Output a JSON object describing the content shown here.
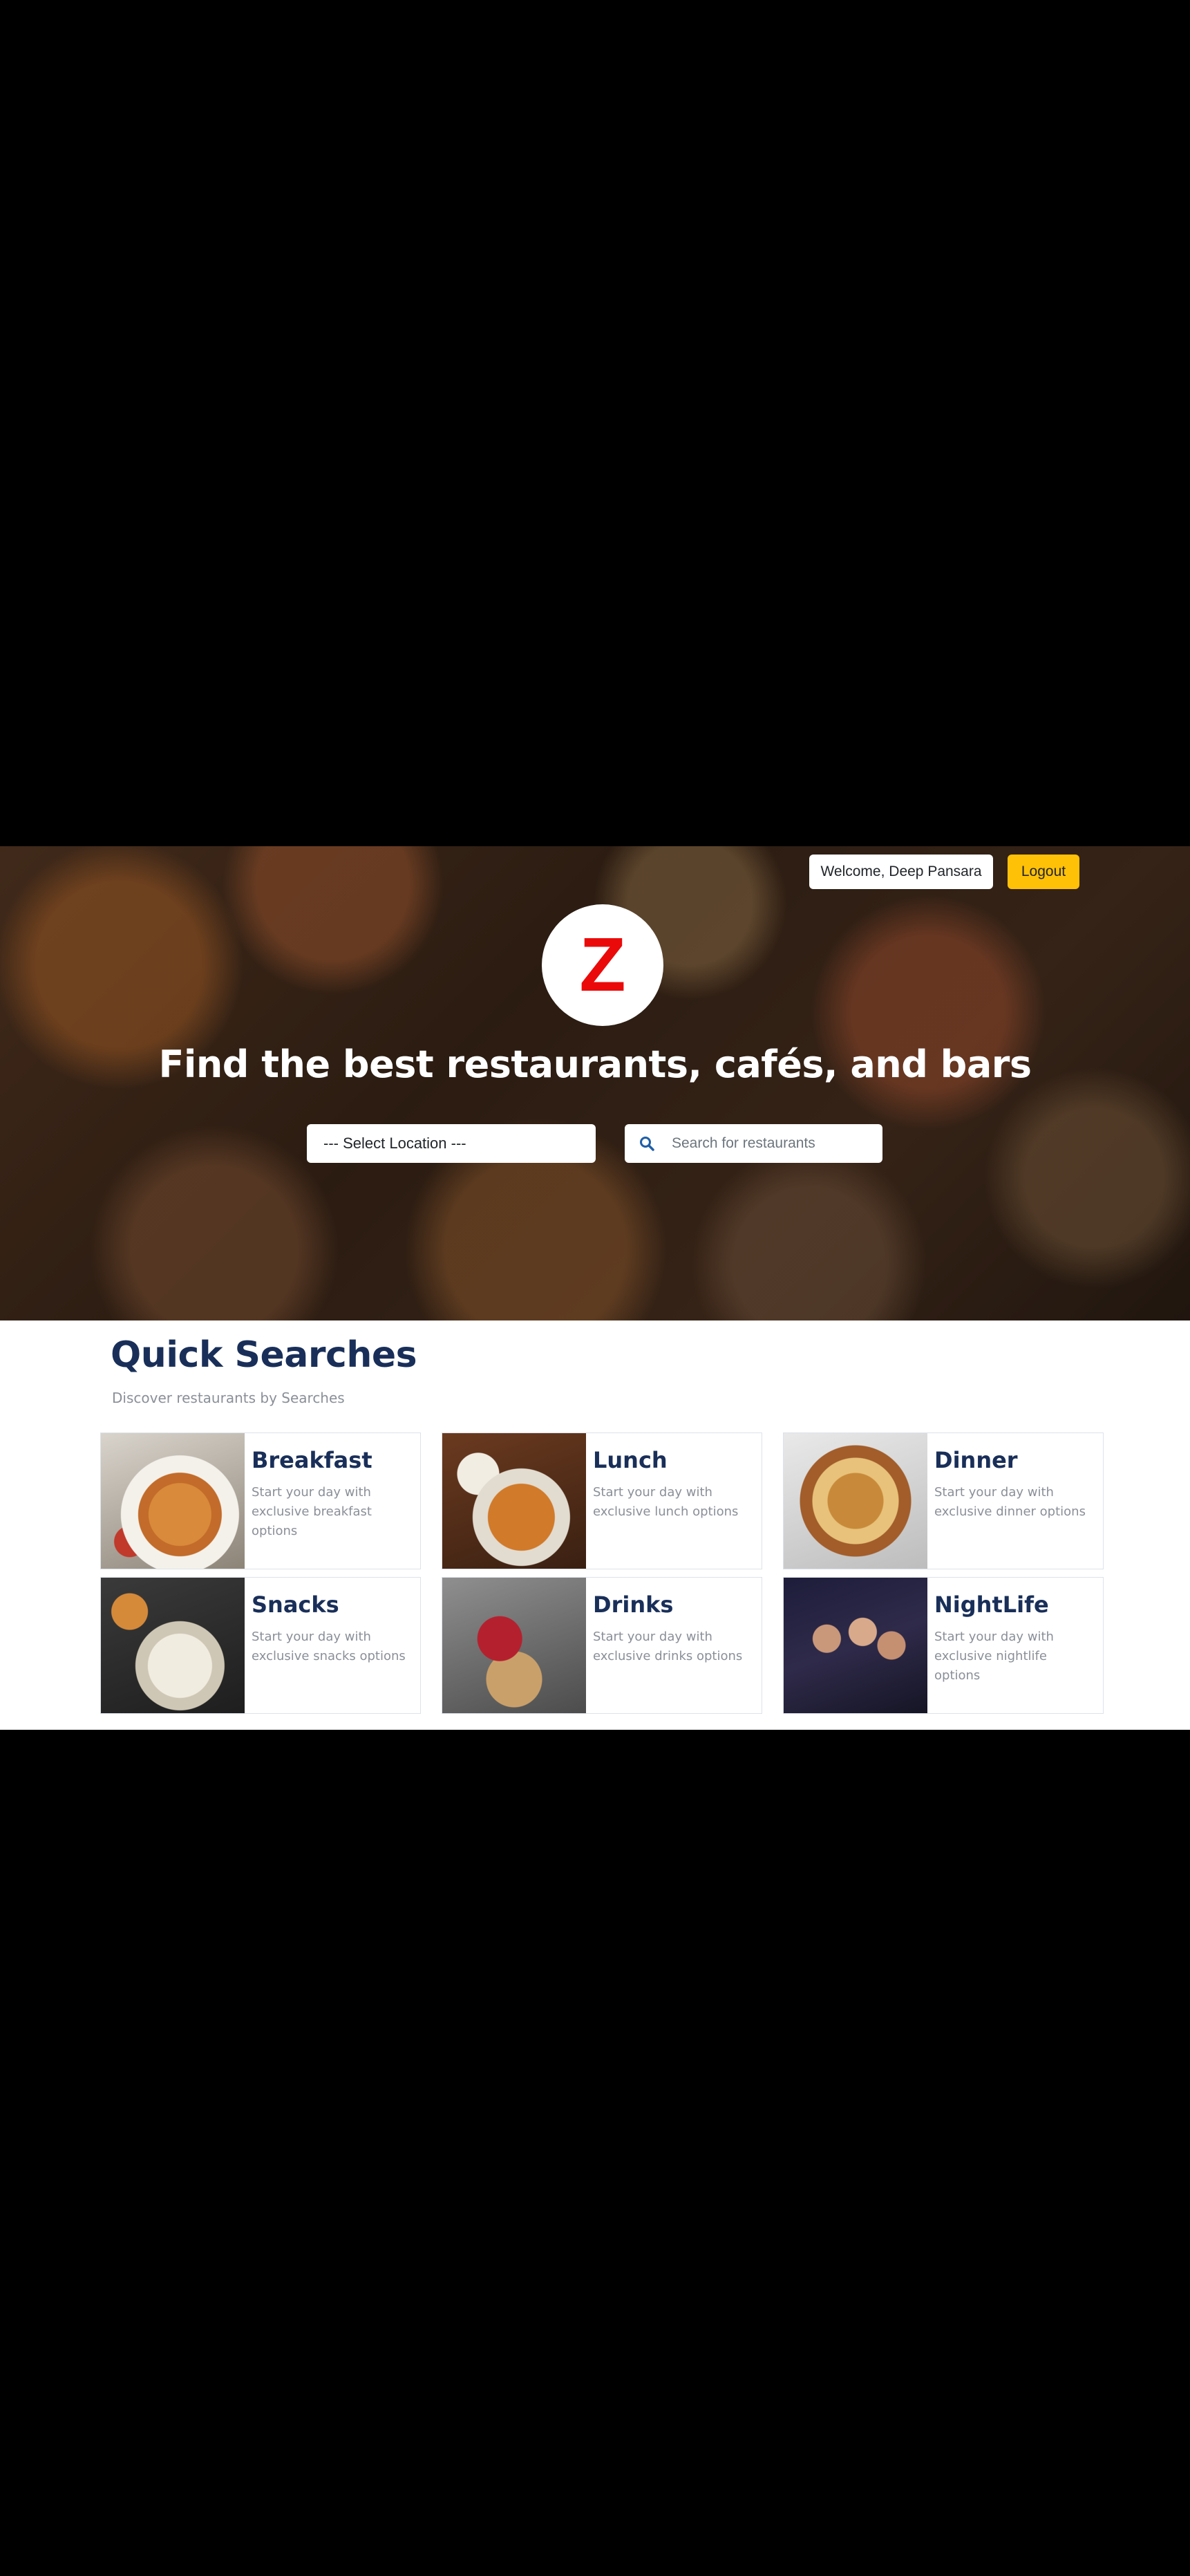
{
  "header": {
    "welcome_label": "Welcome, Deep Pansara",
    "logout_label": "Logout"
  },
  "logo": {
    "letter": "Z",
    "color": "#eb0a0a"
  },
  "hero": {
    "title": "Find the best restaurants, cafés, and bars",
    "location_select": {
      "selected": "--- Select Location ---"
    },
    "search": {
      "placeholder": "Search for restaurants",
      "icon": "search-icon"
    }
  },
  "quick_searches": {
    "heading": "Quick Searches",
    "subheading": "Discover restaurants by Searches",
    "cards": [
      {
        "title": "Breakfast",
        "description": "Start your day with exclusive breakfast options"
      },
      {
        "title": "Lunch",
        "description": "Start your day with exclusive lunch options"
      },
      {
        "title": "Dinner",
        "description": "Start your day with exclusive dinner options"
      },
      {
        "title": "Snacks",
        "description": "Start your day with exclusive snacks options"
      },
      {
        "title": "Drinks",
        "description": "Start your day with exclusive drinks options"
      },
      {
        "title": "NightLife",
        "description": "Start your day with exclusive nightlife options"
      }
    ]
  },
  "colors": {
    "accent_yellow": "#ffc107",
    "heading_navy": "#192f59",
    "muted_text": "#8a8f98",
    "search_icon": "#1f5fa8"
  }
}
